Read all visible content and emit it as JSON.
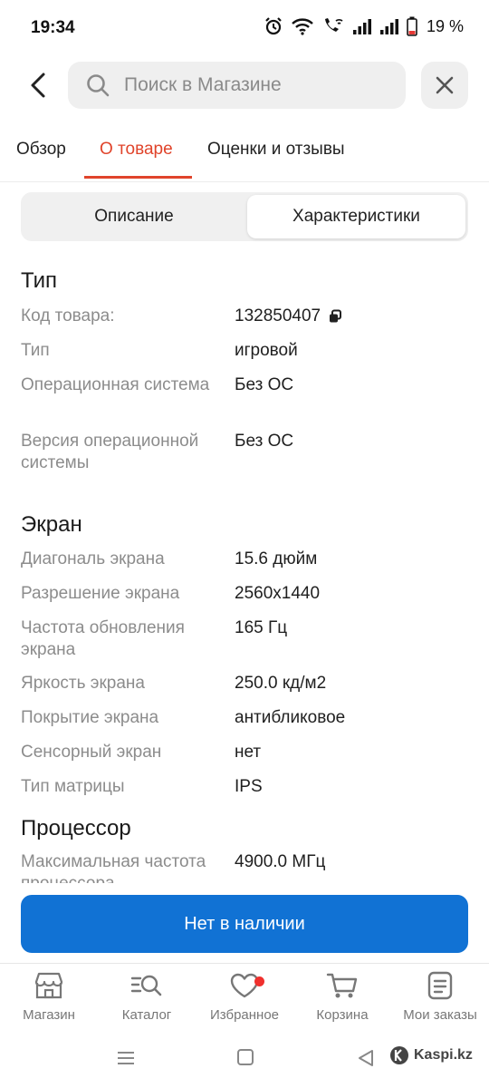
{
  "status_bar": {
    "time": "19:34",
    "battery": "19 %",
    "icons": [
      "alarm-icon",
      "wifi-icon",
      "wifi-call-icon",
      "signal-icon",
      "signal-icon",
      "battery-icon"
    ]
  },
  "search": {
    "placeholder": "Поиск в Магазине"
  },
  "tabs": [
    {
      "label": "Обзор",
      "active": false
    },
    {
      "label": "О товаре",
      "active": true
    },
    {
      "label": "Оценки и отзывы",
      "active": false
    }
  ],
  "segments": {
    "left": "Описание",
    "right": "Характеристики",
    "selected": "right"
  },
  "specs": {
    "sections": [
      {
        "title": "Тип",
        "rows": [
          {
            "label": "Код товара:",
            "value": "132850407"
          },
          {
            "label": "Тип",
            "value": "игровой"
          },
          {
            "label": "Операционная система",
            "value": "Без ОС"
          },
          {
            "label": "Версия операционной системы",
            "value": "Без ОС"
          }
        ]
      },
      {
        "title": "Экран",
        "rows": [
          {
            "label": "Диагональ экрана",
            "value": "15.6 дюйм"
          },
          {
            "label": "Разрешение экрана",
            "value": "2560x1440"
          },
          {
            "label": "Частота обновления экрана",
            "value": "165 Гц"
          },
          {
            "label": "Яркость экрана",
            "value": "250.0 кд/м2"
          },
          {
            "label": "Покрытие экрана",
            "value": "антибликовое"
          },
          {
            "label": "Сенсорный экран",
            "value": "нет"
          },
          {
            "label": "Тип матрицы",
            "value": "IPS"
          }
        ]
      },
      {
        "title": "Процессор",
        "rows": [
          {
            "label": "Максимальная частота процессора",
            "value": "4900.0 МГц"
          }
        ]
      }
    ]
  },
  "cta": {
    "label": "Нет в наличии",
    "color": "#1172d4"
  },
  "bottom_nav": [
    {
      "label": "Магазин",
      "icon": "store-icon"
    },
    {
      "label": "Каталог",
      "icon": "catalog-search-icon"
    },
    {
      "label": "Избранное",
      "icon": "heart-icon",
      "badge": true
    },
    {
      "label": "Корзина",
      "icon": "cart-icon"
    },
    {
      "label": "Мои заказы",
      "icon": "orders-icon"
    }
  ],
  "watermark": "Kaspi.kz",
  "colors": {
    "accent": "#e0442b",
    "primary": "#1172d4",
    "label_gray": "#8c8c8c"
  }
}
